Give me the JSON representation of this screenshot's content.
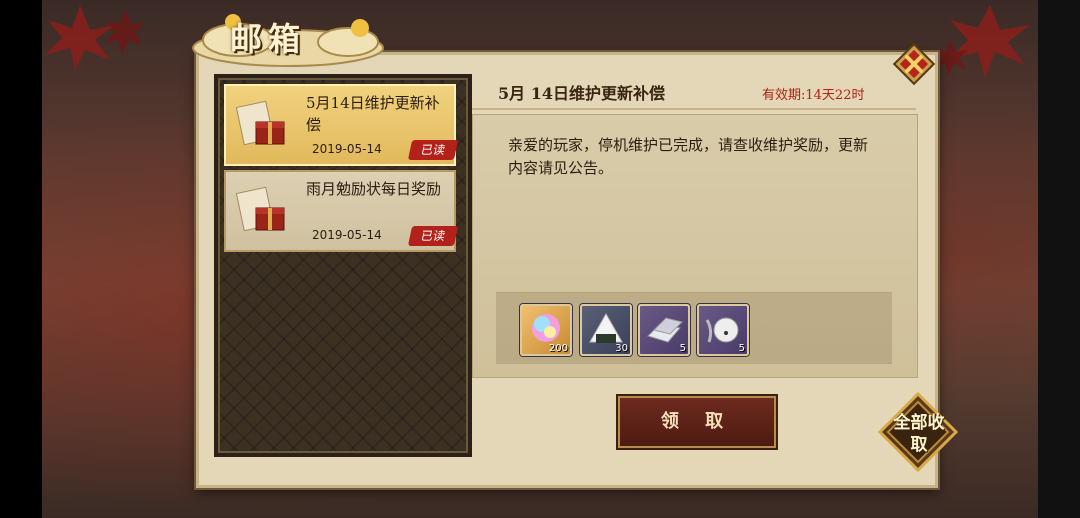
{
  "window": {
    "title": "邮箱"
  },
  "mails": [
    {
      "title": "5月14日维护更新补偿",
      "date": "2019-05-14",
      "status": "已读",
      "selected": true
    },
    {
      "title": "雨月勉励状每日奖励",
      "date": "2019-05-14",
      "status": "已读",
      "selected": false
    }
  ],
  "detail": {
    "title": "5月 14日维护更新补偿",
    "validity": "有效期:14天22时",
    "body": "亲爱的玩家，停机维护已完成，请查收维护奖励，更新内容请见公告。",
    "rewards": [
      {
        "icon": "rainbow-orb-icon",
        "count": "200",
        "color": "#d8a040"
      },
      {
        "icon": "rice-ball-icon",
        "count": "30",
        "color": "#4a5068"
      },
      {
        "icon": "silver-ingot-icon",
        "count": "5",
        "color": "#5a4a78"
      },
      {
        "icon": "bell-charm-icon",
        "count": "5",
        "color": "#5a4a78"
      }
    ]
  },
  "buttons": {
    "claim": "领 取",
    "claim_all": "全部收取"
  },
  "colors": {
    "accent": "#b02015",
    "panel": "#e3d7b8",
    "selected": "#e9c46b"
  }
}
